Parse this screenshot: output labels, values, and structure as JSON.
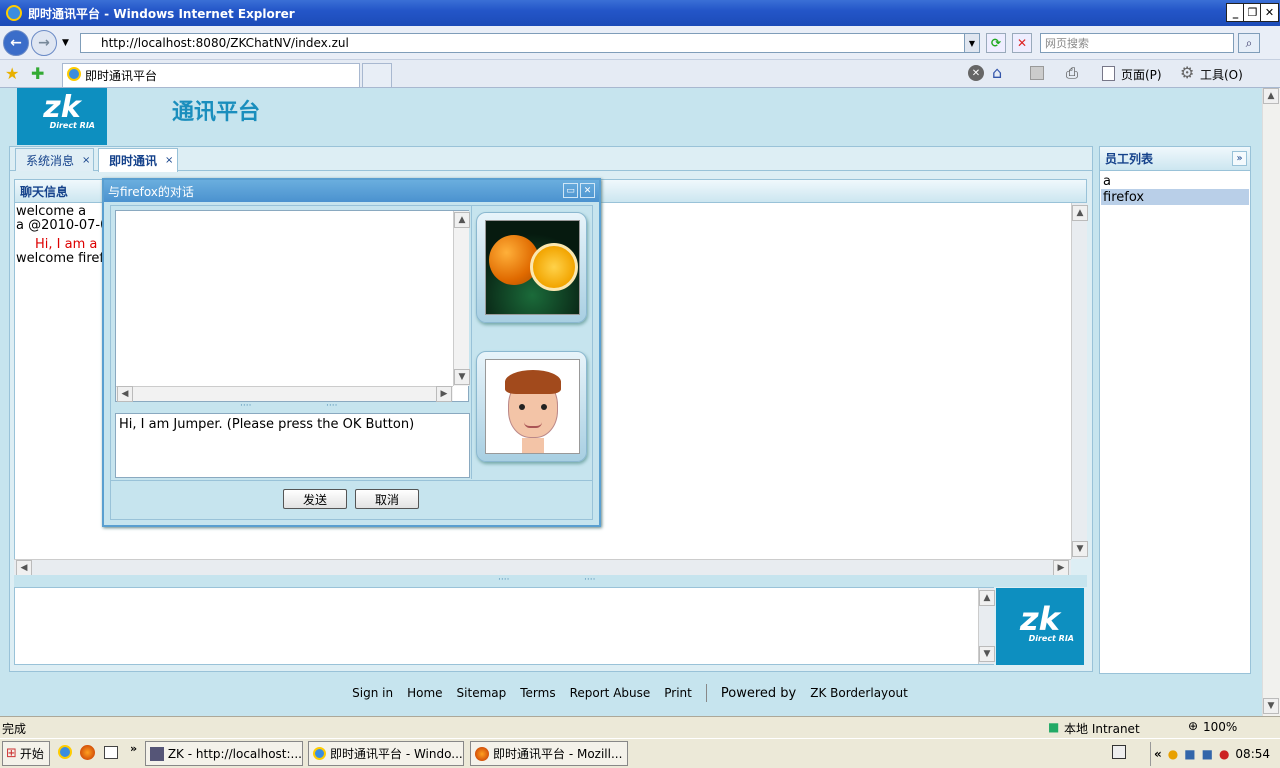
{
  "window": {
    "title": "即时通讯平台 - Windows Internet Explorer"
  },
  "browser": {
    "url": "http://localhost:8080/ZKChatNV/index.zul",
    "search_placeholder": "网页搜索",
    "tab_title": "即时通讯平台",
    "page_menu": "页面(P)",
    "tools_menu": "工具(O)"
  },
  "app": {
    "title": "通讯平台",
    "logo_text": "zk",
    "logo_sub": "Direct RIA",
    "tabs": [
      {
        "label": "系统消息",
        "close": "×"
      },
      {
        "label": "即时通讯",
        "close": "×"
      }
    ],
    "chat_panel_title": "聊天信息",
    "messages": [
      {
        "text": "welcome a",
        "color": "#000000"
      },
      {
        "text": "a @2010-07-0",
        "color": "#000000"
      },
      {
        "text": "Hi, I am a !",
        "color": "#dd0000"
      },
      {
        "text": "welcome firefo",
        "color": "#000000"
      }
    ]
  },
  "employees": {
    "title": "员工列表",
    "items": [
      "a",
      "firefox"
    ],
    "selected": "firefox"
  },
  "dialog": {
    "title": "与firefox的对话",
    "input_value": "Hi, I am Jumper. (Please press the OK Button)",
    "send_label": "发送",
    "cancel_label": "取消"
  },
  "footer": {
    "links": [
      "Sign in",
      "Home",
      "Sitemap",
      "Terms",
      "Report Abuse",
      "Print"
    ],
    "powered": "Powered by",
    "powered_link": "ZK Borderlayout"
  },
  "status": {
    "text": "完成",
    "zone": "本地 Intranet",
    "zoom": "100%"
  },
  "taskbar": {
    "start": "开始",
    "tasks": [
      "ZK - http://localhost:...",
      "即时通讯平台 - Windo...",
      "即时通讯平台 - Mozill..."
    ],
    "clock": "08:54"
  },
  "colors": {
    "accent": "#0d8fc0",
    "panel": "#c6e4ee",
    "title_text": "#15428b"
  }
}
